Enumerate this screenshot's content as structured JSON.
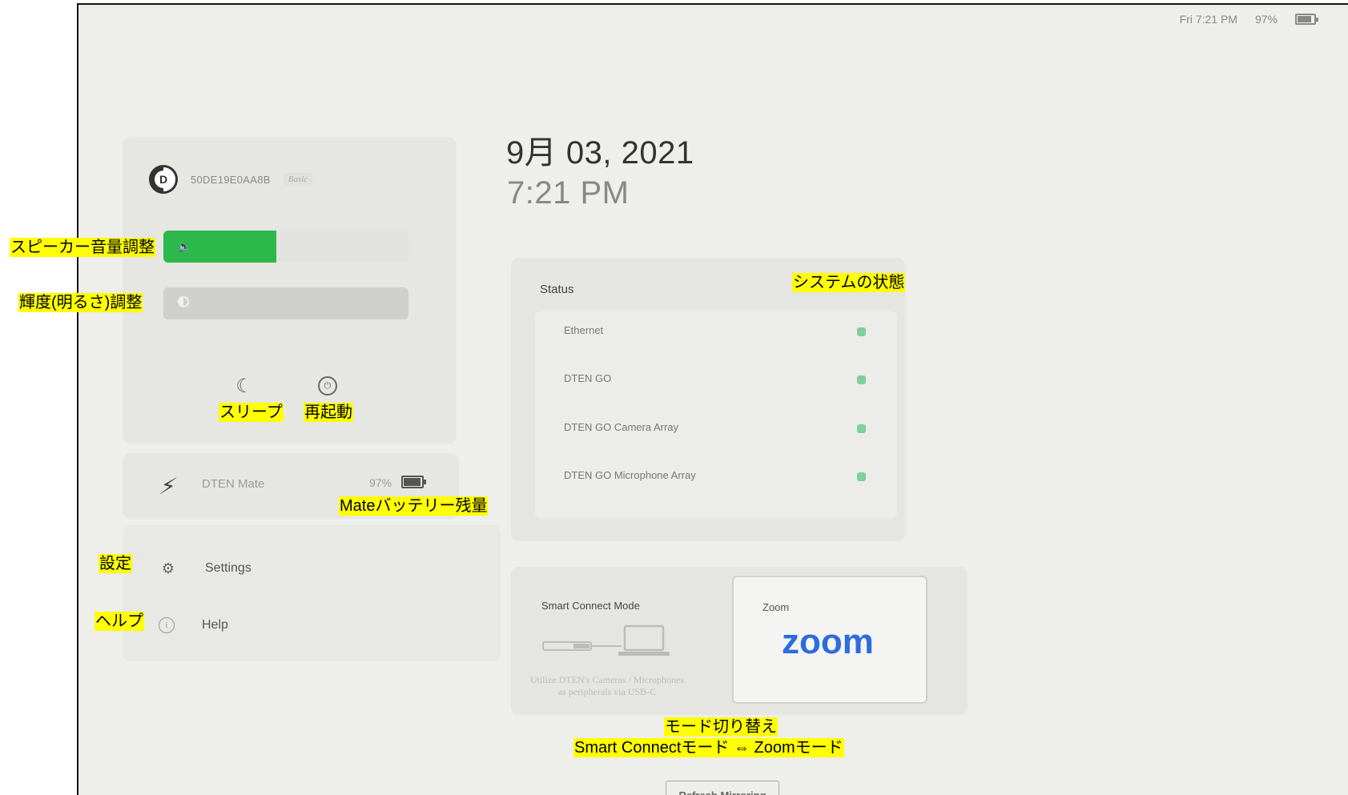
{
  "topbar": {
    "datetime": "Fri 7:21 PM",
    "battery": "97%"
  },
  "device": {
    "id": "50DE19E0AA8B",
    "tag": "Basic",
    "logo_letter": "D"
  },
  "sliders": {
    "volume_level": 0.46,
    "brightness_level": 0.0
  },
  "controls": {
    "sleep_icon": "moon-icon",
    "restart_icon": "restart-icon"
  },
  "mate": {
    "name": "DTEN Mate",
    "battery": "97%"
  },
  "menu": {
    "settings": "Settings",
    "help": "Help"
  },
  "clock": {
    "date": "9月 03, 2021",
    "time": "7:21 PM"
  },
  "status": {
    "title": "Status",
    "items": [
      {
        "label": "Ethernet"
      },
      {
        "label": "DTEN GO"
      },
      {
        "label": "DTEN GO Camera Array"
      },
      {
        "label": "DTEN GO Microphone Array"
      }
    ],
    "ok_color": "#7fd09a"
  },
  "modes": {
    "smart_title": "Smart Connect Mode",
    "smart_desc_1": "Utilize DTEN's Cameras / Microphones",
    "smart_desc_2": "as peripherals via USB-C",
    "zoom_title": "Zoom",
    "zoom_logo": "zoom"
  },
  "refresh_label": "Refresh Mirroring",
  "annotations": {
    "speaker": "スピーカー音量調整",
    "brightness": "輝度(明るさ)調整",
    "sleep": "スリープ",
    "restart": "再起動",
    "mate_battery": "Mateバッテリー残量",
    "settings": "設定",
    "help": "ヘルプ",
    "system_status": "システムの状態",
    "mode_switch_1": "モード切り替え",
    "mode_switch_2": "Smart Connectモード ⇔ Zoomモード"
  }
}
